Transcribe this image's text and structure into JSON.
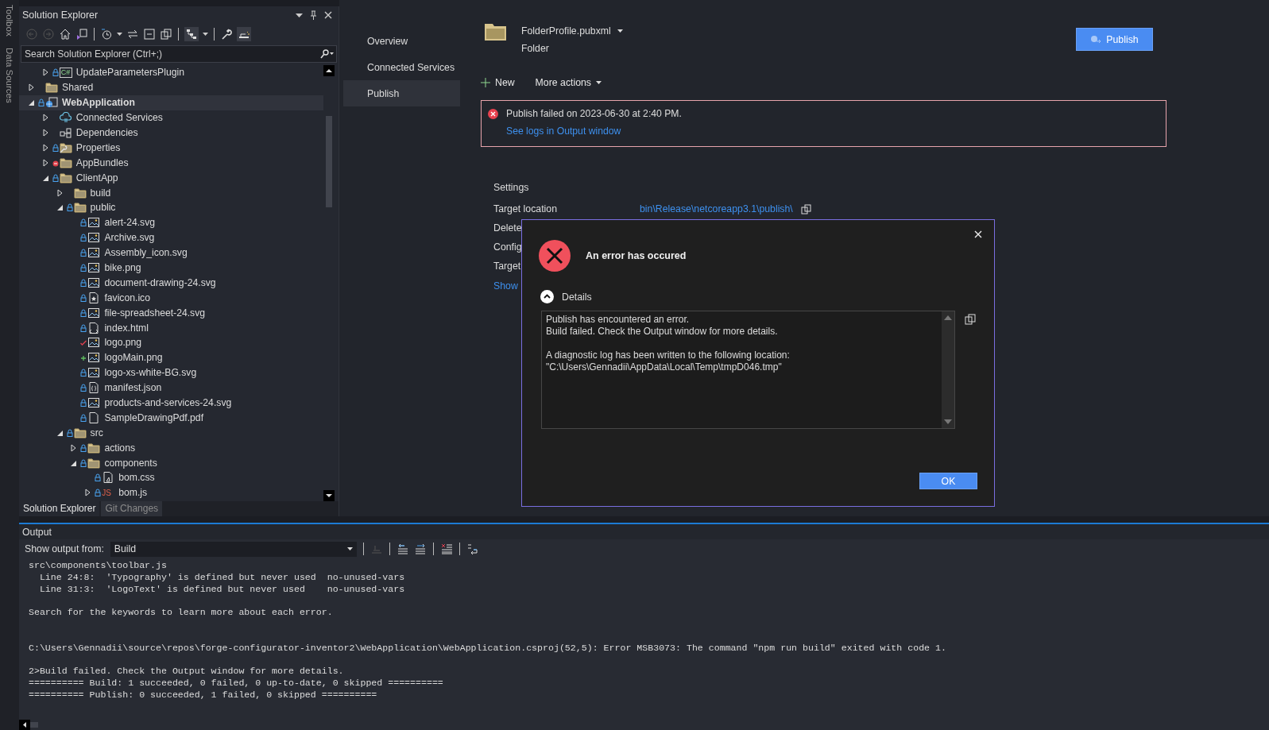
{
  "side_strip": [
    "Toolbox",
    "Data Sources"
  ],
  "solution_explorer": {
    "title": "Solution Explorer",
    "search": {
      "placeholder": "Search Solution Explorer (Ctrl+;)"
    },
    "tree": [
      {
        "children": [
          {
            "label": "UpdateParametersPlugin",
            "kind": "csharp",
            "icon_text": "C#",
            "locked": true,
            "excluded": false,
            "modified": false,
            "added": false,
            "expanded": false,
            "selected": false
          }
        ]
      },
      {
        "label": "Shared",
        "kind": "folder",
        "locked": false,
        "excluded": false,
        "modified": false,
        "added": false,
        "expanded": false,
        "selected": false
      },
      {
        "label": "WebApplication",
        "kind": "web",
        "locked": true,
        "excluded": false,
        "modified": false,
        "added": false,
        "expanded": true,
        "selected": true,
        "children": [
          {
            "label": "Connected Services",
            "kind": "cloud",
            "locked": false,
            "excluded": false,
            "modified": false,
            "added": false,
            "expanded": false,
            "selected": false
          },
          {
            "label": "Dependencies",
            "kind": "deps",
            "locked": false,
            "excluded": false,
            "modified": false,
            "added": false,
            "expanded": false,
            "selected": false
          },
          {
            "label": "Properties",
            "kind": "props",
            "locked": true,
            "excluded": false,
            "modified": false,
            "added": false,
            "expanded": false,
            "selected": false
          },
          {
            "label": "AppBundles",
            "kind": "folder",
            "locked": false,
            "excluded": true,
            "modified": false,
            "added": false,
            "expanded": false,
            "selected": false
          },
          {
            "label": "ClientApp",
            "kind": "folder",
            "locked": true,
            "excluded": false,
            "modified": false,
            "added": false,
            "expanded": true,
            "selected": false,
            "children": [
              {
                "label": "build",
                "kind": "folder",
                "locked": false,
                "excluded": false,
                "modified": false,
                "added": false,
                "expanded": false,
                "selected": false
              },
              {
                "label": "public",
                "kind": "folder",
                "locked": true,
                "excluded": false,
                "modified": false,
                "added": false,
                "expanded": true,
                "selected": false,
                "children": [
                  {
                    "label": "alert-24.svg",
                    "kind": "image",
                    "locked": true,
                    "excluded": false,
                    "modified": false,
                    "added": false,
                    "selected": false
                  },
                  {
                    "label": "Archive.svg",
                    "kind": "image",
                    "locked": true,
                    "excluded": false,
                    "modified": false,
                    "added": false,
                    "selected": false
                  },
                  {
                    "label": "Assembly_icon.svg",
                    "kind": "image",
                    "locked": true,
                    "excluded": false,
                    "modified": false,
                    "added": false,
                    "selected": false
                  },
                  {
                    "label": "bike.png",
                    "kind": "image",
                    "locked": true,
                    "excluded": false,
                    "modified": false,
                    "added": false,
                    "selected": false
                  },
                  {
                    "label": "document-drawing-24.svg",
                    "kind": "image",
                    "locked": true,
                    "excluded": false,
                    "modified": false,
                    "added": false,
                    "selected": false
                  },
                  {
                    "label": "favicon.ico",
                    "kind": "favicon",
                    "locked": true,
                    "excluded": false,
                    "modified": false,
                    "added": false,
                    "selected": false
                  },
                  {
                    "label": "file-spreadsheet-24.svg",
                    "kind": "image",
                    "locked": true,
                    "excluded": false,
                    "modified": false,
                    "added": false,
                    "selected": false
                  },
                  {
                    "label": "index.html",
                    "kind": "html",
                    "locked": true,
                    "excluded": false,
                    "modified": false,
                    "added": false,
                    "selected": false
                  },
                  {
                    "label": "logo.png",
                    "kind": "image",
                    "locked": false,
                    "excluded": false,
                    "modified": true,
                    "added": false,
                    "selected": false
                  },
                  {
                    "label": "logoMain.png",
                    "kind": "image",
                    "locked": false,
                    "excluded": false,
                    "modified": false,
                    "added": true,
                    "selected": false
                  },
                  {
                    "label": "logo-xs-white-BG.svg",
                    "kind": "image",
                    "locked": true,
                    "excluded": false,
                    "modified": false,
                    "added": false,
                    "selected": false
                  },
                  {
                    "label": "manifest.json",
                    "kind": "json",
                    "locked": true,
                    "excluded": false,
                    "modified": false,
                    "added": false,
                    "selected": false
                  },
                  {
                    "label": "products-and-services-24.svg",
                    "kind": "image",
                    "locked": true,
                    "excluded": false,
                    "modified": false,
                    "added": false,
                    "selected": false
                  },
                  {
                    "label": "SampleDrawingPdf.pdf",
                    "kind": "file",
                    "locked": true,
                    "excluded": false,
                    "modified": false,
                    "added": false,
                    "selected": false
                  }
                ]
              },
              {
                "label": "src",
                "kind": "folder",
                "locked": true,
                "excluded": false,
                "modified": false,
                "added": false,
                "expanded": true,
                "selected": false,
                "children": [
                  {
                    "label": "actions",
                    "kind": "folder",
                    "locked": true,
                    "excluded": false,
                    "modified": false,
                    "added": false,
                    "expanded": false,
                    "selected": false
                  },
                  {
                    "label": "components",
                    "kind": "folder",
                    "locked": true,
                    "excluded": false,
                    "modified": false,
                    "added": false,
                    "expanded": true,
                    "selected": false,
                    "children": [
                      {
                        "label": "bom.css",
                        "kind": "css",
                        "locked": true,
                        "excluded": false,
                        "modified": false,
                        "added": false,
                        "selected": false
                      },
                      {
                        "label": "bom.js",
                        "kind": "js",
                        "icon_text": "JS",
                        "locked": true,
                        "excluded": false,
                        "modified": false,
                        "added": false,
                        "expanded": false,
                        "selected": false
                      }
                    ]
                  }
                ]
              }
            ]
          }
        ]
      }
    ],
    "tabs": [
      {
        "label": "Solution Explorer",
        "selected": true
      },
      {
        "label": "Git Changes",
        "selected": false
      }
    ]
  },
  "publish": {
    "nav": [
      {
        "label": "Overview",
        "selected": false
      },
      {
        "label": "Connected Services",
        "selected": false
      },
      {
        "label": "Publish",
        "selected": true
      }
    ],
    "profile": {
      "name": "FolderProfile.pubxml",
      "type": "Folder"
    },
    "publish_button": "Publish",
    "actions": [
      "New",
      "More actions"
    ],
    "banner": {
      "message": "Publish failed on 2023-06-30 at 2:40 PM.",
      "link": "See logs in Output window"
    },
    "settings": {
      "heading": "Settings",
      "rows": [
        {
          "label": "Target location",
          "value": "bin\\Release\\netcoreapp3.1\\publish\\"
        },
        {
          "label": "Delete"
        },
        {
          "label": "Config"
        },
        {
          "label": "Target"
        }
      ],
      "show_link": "Show"
    }
  },
  "dialog": {
    "title": "An error has occured",
    "details": {
      "label": "Details",
      "expanded": true,
      "paragraphs": [
        [
          "Publish has encountered an error.",
          "Build failed. Check the Output window for more details."
        ],
        [
          "A diagnostic log has been written to the following location:",
          "\"C:\\Users\\Gennadii\\AppData\\Local\\Temp\\tmpD046.tmp\""
        ]
      ]
    },
    "ok": "OK"
  },
  "output": {
    "title": "Output",
    "source_label": "Show output from:",
    "source": "Build",
    "blocks": [
      {
        "wide_gap": false,
        "lines": [
          "src\\components\\toolbar.js",
          "  Line 24:8:  'Typography' is defined but never used  no-unused-vars",
          "  Line 31:3:  'LogoText' is defined but never used    no-unused-vars"
        ]
      },
      {
        "wide_gap": false,
        "lines": [
          "Search for the keywords to learn more about each error."
        ]
      },
      {
        "wide_gap": true,
        "lines": [
          "C:\\Users\\Gennadii\\source\\repos\\forge-configurator-inventor2\\WebApplication\\WebApplication.csproj(52,5): Error MSB3073: The command \"npm run build\" exited with code 1."
        ]
      },
      {
        "wide_gap": false,
        "lines": [
          "2>Build failed. Check the Output window for more details.",
          "========== Build: 1 succeeded, 0 failed, 0 up-to-date, 0 skipped ==========",
          "========== Publish: 0 succeeded, 1 failed, 0 skipped =========="
        ]
      }
    ]
  }
}
